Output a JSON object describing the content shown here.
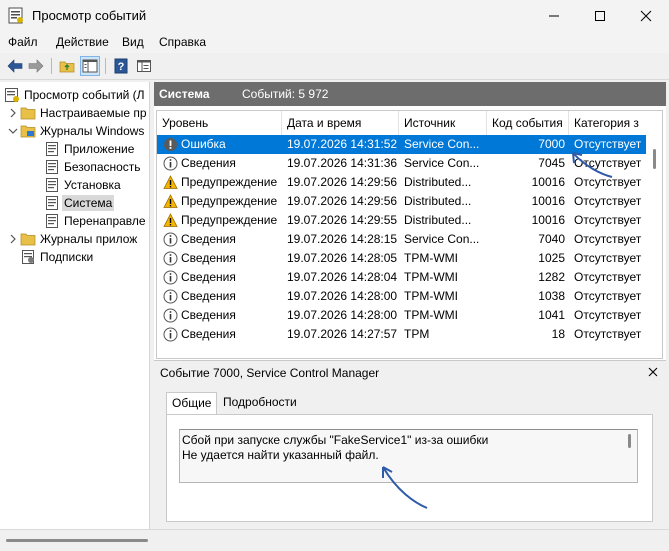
{
  "window": {
    "title": "Просмотр событий"
  },
  "menu": [
    "Файл",
    "Действие",
    "Вид",
    "Справка"
  ],
  "toolbar": {
    "icons": [
      "back-arrow-icon",
      "forward-arrow-icon",
      "folder-up-icon",
      "show-hide-tree-icon",
      "help-icon",
      "properties-icon"
    ]
  },
  "tree": [
    {
      "label": "Просмотр событий (Л",
      "icon": "event-viewer-icon",
      "expander": ""
    },
    {
      "label": "Настраиваемые пр",
      "icon": "folder-icon",
      "expander": "collapsed"
    },
    {
      "label": "Журналы Windows",
      "icon": "folder-icon",
      "expander": "expanded"
    },
    {
      "label": "Приложение",
      "icon": "log-icon",
      "expander": ""
    },
    {
      "label": "Безопасность",
      "icon": "log-icon",
      "expander": ""
    },
    {
      "label": "Установка",
      "icon": "log-icon",
      "expander": ""
    },
    {
      "label": "Система",
      "icon": "log-icon",
      "expander": "",
      "selected": true
    },
    {
      "label": "Перенаправле",
      "icon": "log-icon",
      "expander": ""
    },
    {
      "label": "Журналы прилож",
      "icon": "folder-icon",
      "expander": "collapsed"
    },
    {
      "label": "Подписки",
      "icon": "subscriptions-icon",
      "expander": ""
    }
  ],
  "list": {
    "title": "Система",
    "count": "Событий: 5 972",
    "columns": [
      "Уровень",
      "Дата и время",
      "Источник",
      "Код события",
      "Категория з"
    ],
    "rows": [
      {
        "level": "Ошибка",
        "icon": "error-icon",
        "date": "19.07.2026 14:31:52",
        "source": "Service Con...",
        "id": "7000",
        "category": "Отсутствует",
        "selected": true
      },
      {
        "level": "Сведения",
        "icon": "info-icon",
        "date": "19.07.2026 14:31:36",
        "source": "Service Con...",
        "id": "7045",
        "category": "Отсутствует"
      },
      {
        "level": "Предупреждение",
        "icon": "warning-icon",
        "date": "19.07.2026 14:29:56",
        "source": "Distributed...",
        "id": "10016",
        "category": "Отсутствует"
      },
      {
        "level": "Предупреждение",
        "icon": "warning-icon",
        "date": "19.07.2026 14:29:56",
        "source": "Distributed...",
        "id": "10016",
        "category": "Отсутствует"
      },
      {
        "level": "Предупреждение",
        "icon": "warning-icon",
        "date": "19.07.2026 14:29:55",
        "source": "Distributed...",
        "id": "10016",
        "category": "Отсутствует"
      },
      {
        "level": "Сведения",
        "icon": "info-icon",
        "date": "19.07.2026 14:28:15",
        "source": "Service Con...",
        "id": "7040",
        "category": "Отсутствует"
      },
      {
        "level": "Сведения",
        "icon": "info-icon",
        "date": "19.07.2026 14:28:05",
        "source": "TPM-WMI",
        "id": "1025",
        "category": "Отсутствует"
      },
      {
        "level": "Сведения",
        "icon": "info-icon",
        "date": "19.07.2026 14:28:04",
        "source": "TPM-WMI",
        "id": "1282",
        "category": "Отсутствует"
      },
      {
        "level": "Сведения",
        "icon": "info-icon",
        "date": "19.07.2026 14:28:00",
        "source": "TPM-WMI",
        "id": "1038",
        "category": "Отсутствует"
      },
      {
        "level": "Сведения",
        "icon": "info-icon",
        "date": "19.07.2026 14:28:00",
        "source": "TPM-WMI",
        "id": "1041",
        "category": "Отсутствует"
      },
      {
        "level": "Сведения",
        "icon": "info-icon",
        "date": "19.07.2026 14:27:57",
        "source": "TPM",
        "id": "18",
        "category": "Отсутствует"
      }
    ]
  },
  "details": {
    "title": "Событие 7000, Service Control Manager",
    "tabs": [
      "Общие",
      "Подробности"
    ],
    "message": [
      "Сбой при запуске службы \"FakeService1\" из-за ошибки",
      "Не удается найти указанный файл."
    ]
  },
  "colors": {
    "selection": "#0078d7",
    "header": "#6d6d6d",
    "arrow": "#2f5aa8"
  }
}
